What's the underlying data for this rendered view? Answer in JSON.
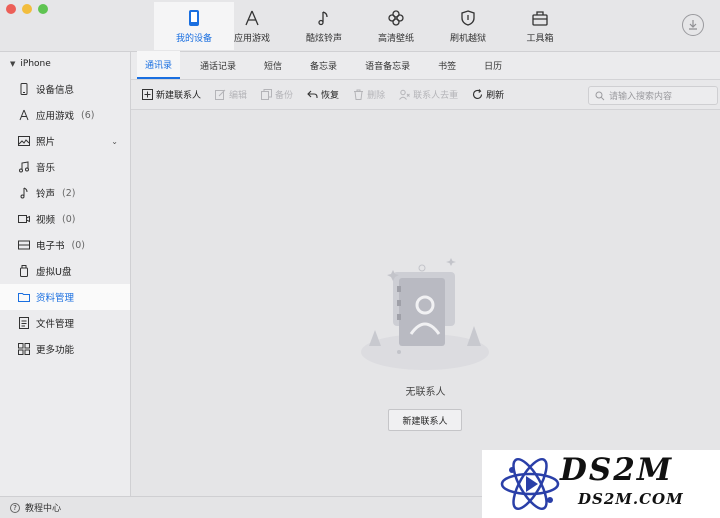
{
  "colors": {
    "accent": "#1a6fe0",
    "disabled": "#b4b4b8",
    "watermark_blue": "#2a3fa8"
  },
  "topnav": [
    {
      "label": "我的设备",
      "icon": "phone-icon",
      "active": true
    },
    {
      "label": "应用游戏",
      "icon": "appstore-icon",
      "active": false
    },
    {
      "label": "酷炫铃声",
      "icon": "music-note-icon",
      "active": false
    },
    {
      "label": "高清壁纸",
      "icon": "flower-icon",
      "active": false
    },
    {
      "label": "刷机越狱",
      "icon": "shield-icon",
      "active": false
    },
    {
      "label": "工具箱",
      "icon": "toolbox-icon",
      "active": false
    }
  ],
  "sidebar": {
    "device_name": "iPhone",
    "items": [
      {
        "label": "设备信息",
        "count": "",
        "icon": "phone-outline-icon"
      },
      {
        "label": "应用游戏",
        "count": "(6)",
        "icon": "appstore-icon"
      },
      {
        "label": "照片",
        "count": "",
        "icon": "image-icon"
      },
      {
        "label": "音乐",
        "count": "",
        "icon": "music-icon"
      },
      {
        "label": "铃声",
        "count": "(2)",
        "icon": "bell-note-icon"
      },
      {
        "label": "视频",
        "count": "(0)",
        "icon": "video-icon"
      },
      {
        "label": "电子书",
        "count": "(0)",
        "icon": "book-icon"
      },
      {
        "label": "虚拟U盘",
        "count": "",
        "icon": "usb-icon"
      },
      {
        "label": "资料管理",
        "count": "",
        "icon": "folder-icon",
        "active": true
      },
      {
        "label": "文件管理",
        "count": "",
        "icon": "file-icon"
      },
      {
        "label": "更多功能",
        "count": "",
        "icon": "grid-icon"
      }
    ]
  },
  "tabs": [
    "通讯录",
    "通话记录",
    "短信",
    "备忘录",
    "语音备忘录",
    "书签",
    "日历"
  ],
  "actions": [
    {
      "label": "新建联系人",
      "icon": "add-icon",
      "enabled": true
    },
    {
      "label": "编辑",
      "icon": "edit-icon",
      "enabled": false
    },
    {
      "label": "备份",
      "icon": "copy-icon",
      "enabled": false
    },
    {
      "label": "恢复",
      "icon": "restore-icon",
      "enabled": true
    },
    {
      "label": "删除",
      "icon": "trash-icon",
      "enabled": false
    },
    {
      "label": "联系人去重",
      "icon": "user-dedupe-icon",
      "enabled": false
    },
    {
      "label": "刷新",
      "icon": "refresh-icon",
      "enabled": true
    }
  ],
  "search": {
    "placeholder": "请输入搜索内容"
  },
  "empty_state": {
    "text": "无联系人",
    "button": "新建联系人"
  },
  "footer": {
    "label": "教程中心"
  },
  "watermark": {
    "title": "DS2M",
    "subtitle": "DS2M.COM"
  }
}
